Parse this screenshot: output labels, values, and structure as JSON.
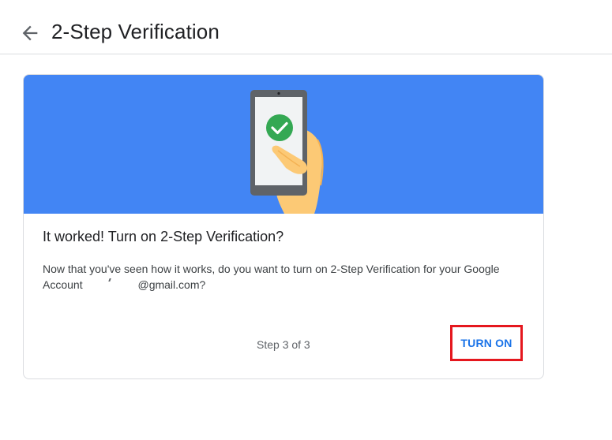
{
  "header": {
    "title": "2-Step Verification",
    "back_icon": "arrow-back-icon"
  },
  "card": {
    "banner_illustration": "phone-with-checkmark-illustration",
    "heading": "It worked! Turn on 2-Step Verification?",
    "body_line1": "Now that you've seen how it works, do you want to turn on 2-Step Verification for your Google",
    "body_line2_prefix": "Account ",
    "body_line2_suffix": "@gmail.com?",
    "step_text": "Step 3 of 3",
    "turn_on_label": "TURN ON"
  },
  "colors": {
    "banner_blue": "#4285f4",
    "button_blue": "#1a73e8",
    "highlight_red": "#e5171e",
    "check_green": "#34a853"
  }
}
